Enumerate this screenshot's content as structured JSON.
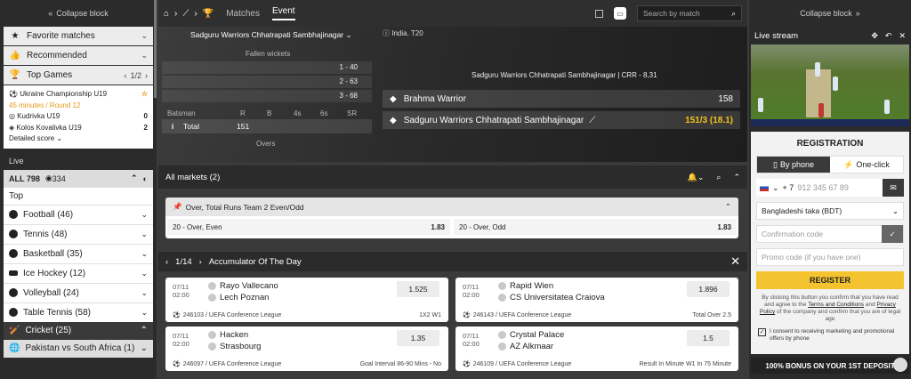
{
  "left": {
    "collapse": "Collapse block",
    "favorite": "Favorite matches",
    "recommended": "Recommended",
    "top_games": "Top Games",
    "top_games_page": "1/2",
    "tg": {
      "league": "Ukraine Championship U19",
      "time": "45 minutes / Round 12",
      "team1": "Kudrivka U19",
      "score1": "0",
      "team2": "Kolos Kovalivka U19",
      "score2": "2",
      "detailed": "Detailed score"
    },
    "live": "Live",
    "all": "ALL 798",
    "count": "334",
    "top": "Top",
    "sports": [
      {
        "name": "Football (46)"
      },
      {
        "name": "Tennis (48)"
      },
      {
        "name": "Basketball (35)"
      },
      {
        "name": "Ice Hockey (12)"
      },
      {
        "name": "Volleyball (24)"
      },
      {
        "name": "Table Tennis (58)"
      }
    ],
    "cricket": "Cricket (25)",
    "pak": "Pakistan vs South Africa (1)"
  },
  "nav": {
    "matches": "Matches",
    "event": "Event",
    "search_placeholder": "Search by match"
  },
  "board": {
    "team_dd": "Sadguru Warriors Chhatrapati Sambhajinagar",
    "fallen": "Fallen wickets",
    "wickets": [
      "1 - 40",
      "2 - 63",
      "3 - 68"
    ],
    "bat_headers": [
      "Batsman",
      "R",
      "B",
      "4s",
      "6s",
      "SR"
    ],
    "total_label": "Total",
    "total_val": "151",
    "overs": "Overs",
    "league": "India. T20",
    "crr": "Sadguru Warriors Chhatrapati Sambhajinagar | CRR - 8,31",
    "team1": "Brahma Warrior",
    "score1": "158",
    "team2": "Sadguru Warriors Chhatrapati Sambhajinagar",
    "score2": "151/3 (18.1)"
  },
  "markets": {
    "title": "All markets (2)",
    "market": "Over, Total Runs Team 2 Even/Odd",
    "o1": "20 - Over, Even",
    "v1": "1.83",
    "o2": "20 - Over, Odd",
    "v2": "1.83"
  },
  "acc": {
    "page": "1/14",
    "title": "Accumulator Of The Day",
    "cards": [
      {
        "date": "07/11",
        "time": "02:00",
        "t1": "Rayo Vallecano",
        "t2": "Lech Poznan",
        "coef": "1.525",
        "league": "246103 / UEFA Conference League",
        "out": "1X2 W1"
      },
      {
        "date": "07/11",
        "time": "02:00",
        "t1": "Rapid Wien",
        "t2": "CS Universitatea Craiova",
        "coef": "1.896",
        "league": "246143 / UEFA Conference League",
        "out": "Total Over 2.5"
      },
      {
        "date": "07/11",
        "time": "02:00",
        "t1": "Hacken",
        "t2": "Strasbourg",
        "coef": "1.35",
        "league": "246097 / UEFA Conference League",
        "out": "Goal Interval 86-90 Mins - No"
      },
      {
        "date": "07/11",
        "time": "02:00",
        "t1": "Crystal Palace",
        "t2": "AZ Alkmaar",
        "coef": "1.5",
        "league": "246109 / UEFA Conference League",
        "out": "Result In Minute W1 In 75 Minute"
      }
    ]
  },
  "right": {
    "collapse": "Collapse block",
    "live_stream": "Live stream",
    "reg_title": "REGISTRATION",
    "by_phone": "By phone",
    "one_click": "One-click",
    "code": "+ 7",
    "phone_ph": "912 345 67 89",
    "currency": "Bangladeshi taka (BDT)",
    "confirm_ph": "Confirmation code",
    "promo_ph": "Promo code (if you have one)",
    "register": "REGISTER",
    "terms1": "By clicking this button you confirm that you have read and agree to the",
    "terms_link": "Terms and Conditions",
    "terms2": "and",
    "privacy_link": "Privacy Policy",
    "terms3": "of the company and confirm that you are of legal age",
    "consent": "I consent to receiving marketing and promotional offers by phone",
    "bonus": "100% BONUS ON YOUR 1ST DEPOSIT"
  }
}
